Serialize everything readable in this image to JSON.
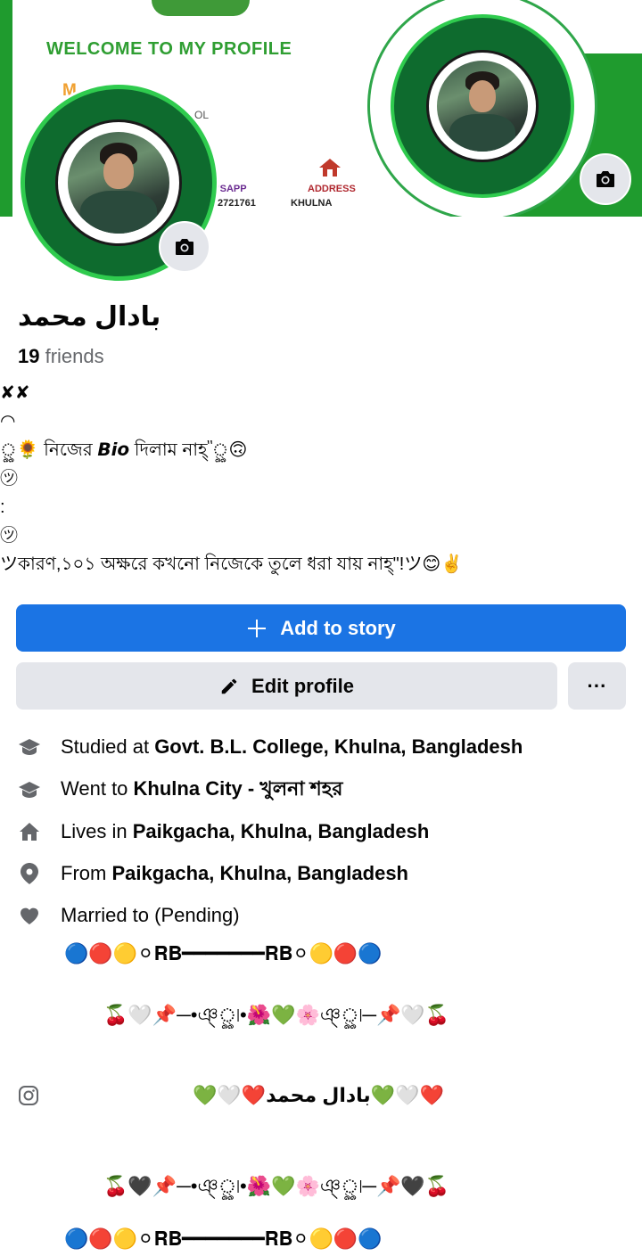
{
  "cover": {
    "title": "WELCOME TO MY PROFILE",
    "name_fragment": "M___AD",
    "ol_fragment": "OL",
    "whatsapp_label": "'SAPP",
    "whatsapp_value": "2721761",
    "address_label": "ADDRESS",
    "address_value": "KHULNA",
    "accent_green": "#1f9b2e"
  },
  "profile": {
    "name": "بادال محمد",
    "friends_count": "19",
    "friends_label": "friends"
  },
  "bio": {
    "lines": [
      "✘✘",
      "◠",
      "ৣ🌻 নিজের 𝘽𝙞𝙤 দিলাম নাহ্\"ৣ🙃",
      "㋡",
      ":",
      "㋡",
      "ツকারণ,১০১ অক্ষরে কখনো নিজেকে তুলে ধরা যায় নাহ্\"!ツ😊✌️"
    ]
  },
  "buttons": {
    "add_story": "Add to story",
    "edit_profile": "Edit profile",
    "more": "···",
    "primary_color": "#1b74e4"
  },
  "details": [
    {
      "icon": "graduation-cap-icon",
      "prefix": "Studied at ",
      "value": "Govt. B.L. College, Khulna, Bangladesh"
    },
    {
      "icon": "graduation-cap-icon",
      "prefix": "Went to ",
      "value": "Khulna City - খুলনা শহর"
    },
    {
      "icon": "home-icon",
      "prefix": "Lives in ",
      "value": "Paikgacha, Khulna, Bangladesh"
    },
    {
      "icon": "location-pin-icon",
      "prefix": "From ",
      "value": "Paikgacha, Khulna, Bangladesh"
    },
    {
      "icon": "heart-icon",
      "prefix": "Married to   (Pending)",
      "value": ""
    }
  ],
  "decor": {
    "line1": "🔵🔴🟡⚪𝐑𝐁━━━━━━━𝐑𝐁⚪🟡🔴🔵",
    "line2": "🍒🤍📌─•ঞ্ৣ৷•🌺💚🌸ঞ্ৣ৷─📌🤍🍒",
    "instagram_icon": "instagram-icon",
    "line3": "💚🤍❤️بادال محمد💚🤍❤️",
    "line4": "🍒🖤📌─•ঞ্ৣ৷•🌺💚🌸ঞ্ৣ৷─📌🖤🍒",
    "line5": "🔵🔴🟡⚪𝐑𝐁━━━━━━━𝐑𝐁⚪🟡🔴🔵"
  }
}
